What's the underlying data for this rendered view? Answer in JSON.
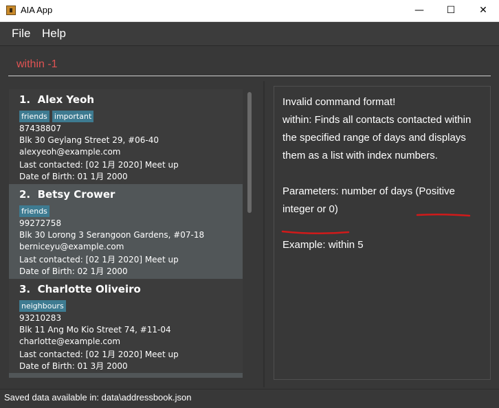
{
  "window": {
    "title": "AIA App",
    "minimize_label": "—",
    "maximize_label": "☐",
    "close_label": "✕"
  },
  "menu": {
    "items": [
      {
        "label": "File"
      },
      {
        "label": "Help"
      }
    ]
  },
  "command_box": {
    "value": "within -1"
  },
  "contacts": [
    {
      "index": "1.",
      "name": "Alex Yeoh",
      "tags": [
        "friends",
        "important"
      ],
      "phone": "87438807",
      "address": "Blk 30 Geylang Street 29, #06-40",
      "email": "alexyeoh@example.com",
      "last_contacted": "Last contacted: [02 1月 2020] Meet up",
      "dob": "Date of Birth: 01 1月 2000"
    },
    {
      "index": "2.",
      "name": "Betsy Crower",
      "tags": [
        "friends"
      ],
      "phone": "99272758",
      "address": "Blk 30 Lorong 3 Serangoon Gardens, #07-18",
      "email": "berniceyu@example.com",
      "last_contacted": "Last contacted: [02 1月 2020] Meet up",
      "dob": "Date of Birth: 02 1月 2000"
    },
    {
      "index": "3.",
      "name": "Charlotte Oliveiro",
      "tags": [
        "neighbours"
      ],
      "phone": "93210283",
      "address": "Blk 11 Ang Mo Kio Street 74, #11-04",
      "email": "charlotte@example.com",
      "last_contacted": "Last contacted: [02 1月 2020] Meet up",
      "dob": "Date of Birth: 01 3月 2000"
    }
  ],
  "result": {
    "text": "Invalid command format!\nwithin: Finds all contacts contacted within the specified range of days and displays them as a list with index numbers.\n\nParameters: number of days (Positive integer or 0)\n\nExample: within 5",
    "annotation_color": "#d11a1a"
  },
  "status": {
    "text": "Saved data available in: data\\addressbook.json"
  },
  "colors": {
    "tag_bg": "#3e7b91",
    "selected_card": "#515658",
    "error_text": "#e05353"
  }
}
